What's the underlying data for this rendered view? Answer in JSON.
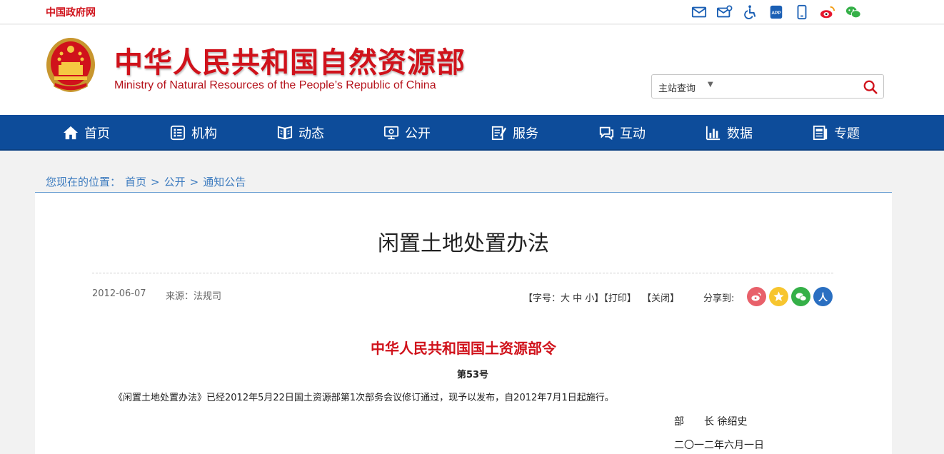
{
  "topbar": {
    "gov_link": "中国政府网",
    "icons": [
      "mail-icon",
      "mail-settings-icon",
      "accessibility-icon",
      "app-icon",
      "mobile-icon",
      "weibo-icon",
      "wechat-icon"
    ],
    "app_label": "APP"
  },
  "header": {
    "title": "中华人民共和国自然资源部",
    "subtitle": "Ministry of Natural Resources of the People’s Republic of China",
    "search": {
      "scope": "主站查询",
      "caret": "▼",
      "placeholder": ""
    }
  },
  "nav": {
    "items": [
      {
        "label": "首页",
        "icon": "home-icon"
      },
      {
        "label": "机构",
        "icon": "org-icon"
      },
      {
        "label": "动态",
        "icon": "news-icon"
      },
      {
        "label": "公开",
        "icon": "disclosure-icon"
      },
      {
        "label": "服务",
        "icon": "service-icon"
      },
      {
        "label": "互动",
        "icon": "interaction-icon"
      },
      {
        "label": "数据",
        "icon": "data-icon"
      },
      {
        "label": "专题",
        "icon": "topic-icon"
      }
    ]
  },
  "breadcrumb": {
    "prefix": "您现在的位置：",
    "items": [
      "首页",
      "公开",
      "通知公告"
    ],
    "separator": ">"
  },
  "article": {
    "title": "闲置土地处置办法",
    "date": "2012-06-07",
    "source": "来源：法规司",
    "tools": {
      "font_label": "【字号：",
      "font_large": "大",
      "font_medium": "中",
      "font_small": "小",
      "font_end": "】",
      "print": "【打印】",
      "close": "【关闭】"
    },
    "share_label": "分享到:",
    "share_icons": [
      {
        "name": "weibo",
        "color": "#e8606a"
      },
      {
        "name": "favorite",
        "color": "#f7c52e"
      },
      {
        "name": "wechat",
        "color": "#35b048"
      },
      {
        "name": "renren",
        "color": "#2a6fc1",
        "glyph": "人"
      }
    ],
    "order_title": "中华人民共和国国土资源部令",
    "order_number": "第53号",
    "body": "《闲置土地处置办法》已经2012年5月22日国土资源部第1次部务会议修订通过，现予以发布，自2012年7月1日起施行。",
    "signature": "部　　长 徐绍史",
    "sign_date": "二〇一二年六月一日"
  },
  "colors": {
    "brand_red": "#d0121b",
    "nav_blue": "#0d4c9a",
    "link_blue": "#3c7bbf"
  }
}
